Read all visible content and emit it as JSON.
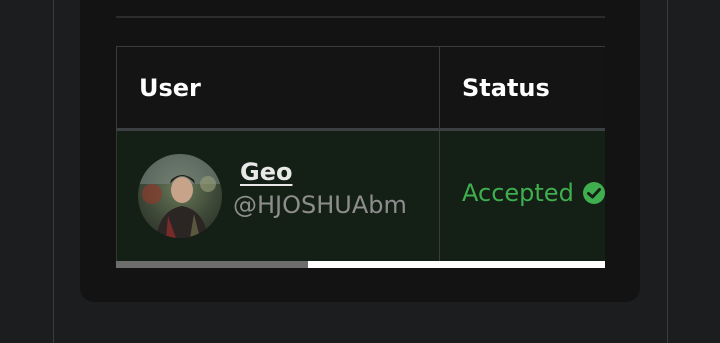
{
  "table": {
    "headers": {
      "user": "User",
      "status": "Status"
    },
    "rows": [
      {
        "name": "Geo",
        "handle": "@HJOSHUAbm",
        "status": "Accepted",
        "status_icon": "check-circle-icon",
        "avatar": "avatar-photo"
      }
    ]
  },
  "colors": {
    "accepted": "#3fae4f",
    "row_highlight": "#141f15",
    "card_bg": "#131313",
    "page_bg": "#1c1d1f"
  },
  "scroll": {
    "horizontal_position": 0.39
  }
}
